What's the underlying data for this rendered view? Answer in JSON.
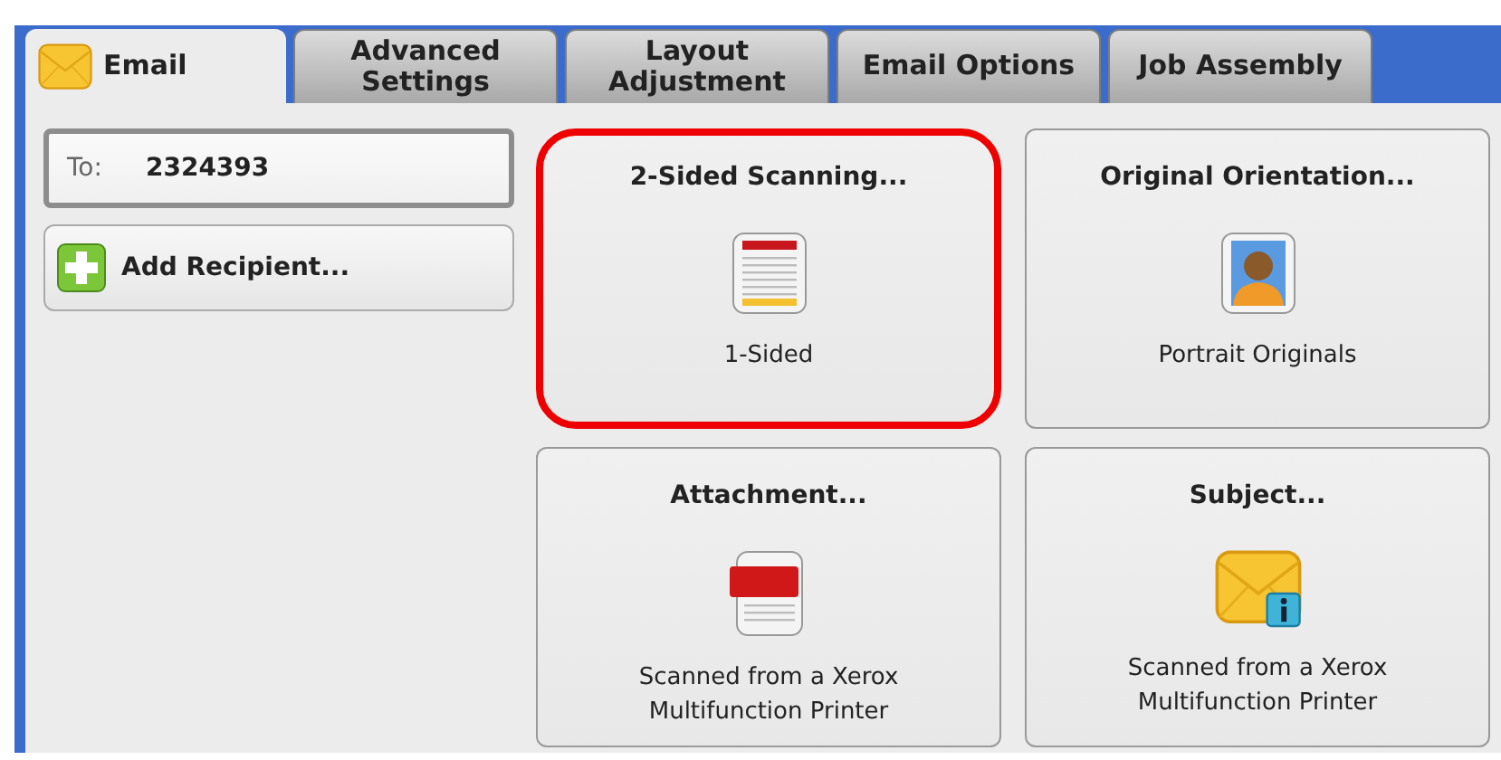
{
  "tabs": [
    {
      "label": "Email",
      "selected": true,
      "icon": true
    },
    {
      "label": "Advanced\nSettings",
      "selected": false
    },
    {
      "label": "Layout\nAdjustment",
      "selected": false
    },
    {
      "label": "Email Options",
      "selected": false
    },
    {
      "label": "Job Assembly",
      "selected": false
    }
  ],
  "recipient": {
    "label": "To:",
    "value": "2324393"
  },
  "add_recipient": {
    "label": "Add Recipient..."
  },
  "tiles": [
    {
      "title": "2-Sided Scanning...",
      "value": "1-Sided",
      "kind": "sides",
      "highlighted": true
    },
    {
      "title": "Original Orientation...",
      "value": "Portrait Originals",
      "kind": "portrait",
      "highlighted": false
    },
    {
      "title": "Attachment...",
      "value": "Scanned from a Xerox\nMultifunction Printer",
      "kind": "pdf",
      "highlighted": false
    },
    {
      "title": "Subject...",
      "value": "Scanned from a Xerox\nMultifunction Printer",
      "kind": "mail-info",
      "highlighted": false
    }
  ]
}
